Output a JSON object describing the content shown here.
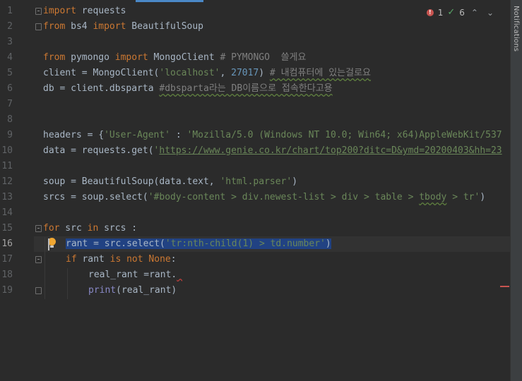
{
  "editor": {
    "lines": [
      {
        "n": "1",
        "text": ""
      },
      {
        "n": "2",
        "text": ""
      },
      {
        "n": "3",
        "text": ""
      },
      {
        "n": "4",
        "text": ""
      },
      {
        "n": "5",
        "text": ""
      },
      {
        "n": "6",
        "text": ""
      },
      {
        "n": "7",
        "text": ""
      },
      {
        "n": "8",
        "text": ""
      },
      {
        "n": "9",
        "text": ""
      },
      {
        "n": "10",
        "text": ""
      },
      {
        "n": "11",
        "text": ""
      },
      {
        "n": "12",
        "text": ""
      },
      {
        "n": "13",
        "text": ""
      },
      {
        "n": "14",
        "text": ""
      },
      {
        "n": "15",
        "text": ""
      },
      {
        "n": "16",
        "text": ""
      },
      {
        "n": "17",
        "text": ""
      },
      {
        "n": "18",
        "text": ""
      },
      {
        "n": "19",
        "text": ""
      }
    ],
    "current_line": "16",
    "code": {
      "l1": {
        "kw": "import",
        "rest": " requests"
      },
      "l2": {
        "kw1": "from",
        "mod": " bs4 ",
        "kw2": "import",
        "rest": " BeautifulSoup"
      },
      "l4": {
        "kw1": "from",
        "mod": " pymongo ",
        "kw2": "import",
        "rest": " MongoClient ",
        "cmt": "# PYMONGO  쓸게요"
      },
      "l5": {
        "a": "client = MongoClient(",
        "s": "'localhost'",
        "c": ", ",
        "n": "27017",
        "d": ") ",
        "cmt": "# 내컴퓨터에 있는걸로요"
      },
      "l6": {
        "a": "db = client.dbsparta ",
        "cmt": "#dbsparta라는 DB이름으로 접속한다고용"
      },
      "l9": {
        "a": "headers = {",
        "s1": "'User-Agent'",
        "b": " : ",
        "s2": "'Mozilla/5.0 (Windows NT 10.0; Win64; x64)AppleWebKit/537"
      },
      "l10": {
        "a": "data = requests.get(",
        "q": "'",
        "url": "https://www.genie.co.kr/chart/top200?ditc=D&ymd=20200403&hh=23"
      },
      "l12": {
        "a": "soup = BeautifulSoup(data.text, ",
        "s": "'html.parser'",
        "b": ")"
      },
      "l13": {
        "a": "srcs = soup.select(",
        "s1": "'#body-content > div.newest-list > div > table > ",
        "u": "tbody",
        "s2": " > tr'",
        "b": ")"
      },
      "l15": {
        "kw1": "for",
        "a": " src ",
        "kw2": "in",
        "b": " srcs :"
      },
      "l16": {
        "a": "rant = src.select(",
        "s": "'tr:nth-child(1) > td.number'",
        "b": ")"
      },
      "l17": {
        "kw1": "if",
        "a": " rant ",
        "kw2": "is not",
        "b": " ",
        "kw3": "None",
        "c": ":"
      },
      "l18": {
        "a": "real_rant =rant."
      },
      "l19": {
        "f": "print",
        "a": "(real_rant)"
      }
    }
  },
  "inspections": {
    "errors": "1",
    "warnings": "6",
    "error_icon": "error-circle-icon",
    "ok_icon": "check-icon"
  },
  "sidebar": {
    "label": "Notifications"
  }
}
